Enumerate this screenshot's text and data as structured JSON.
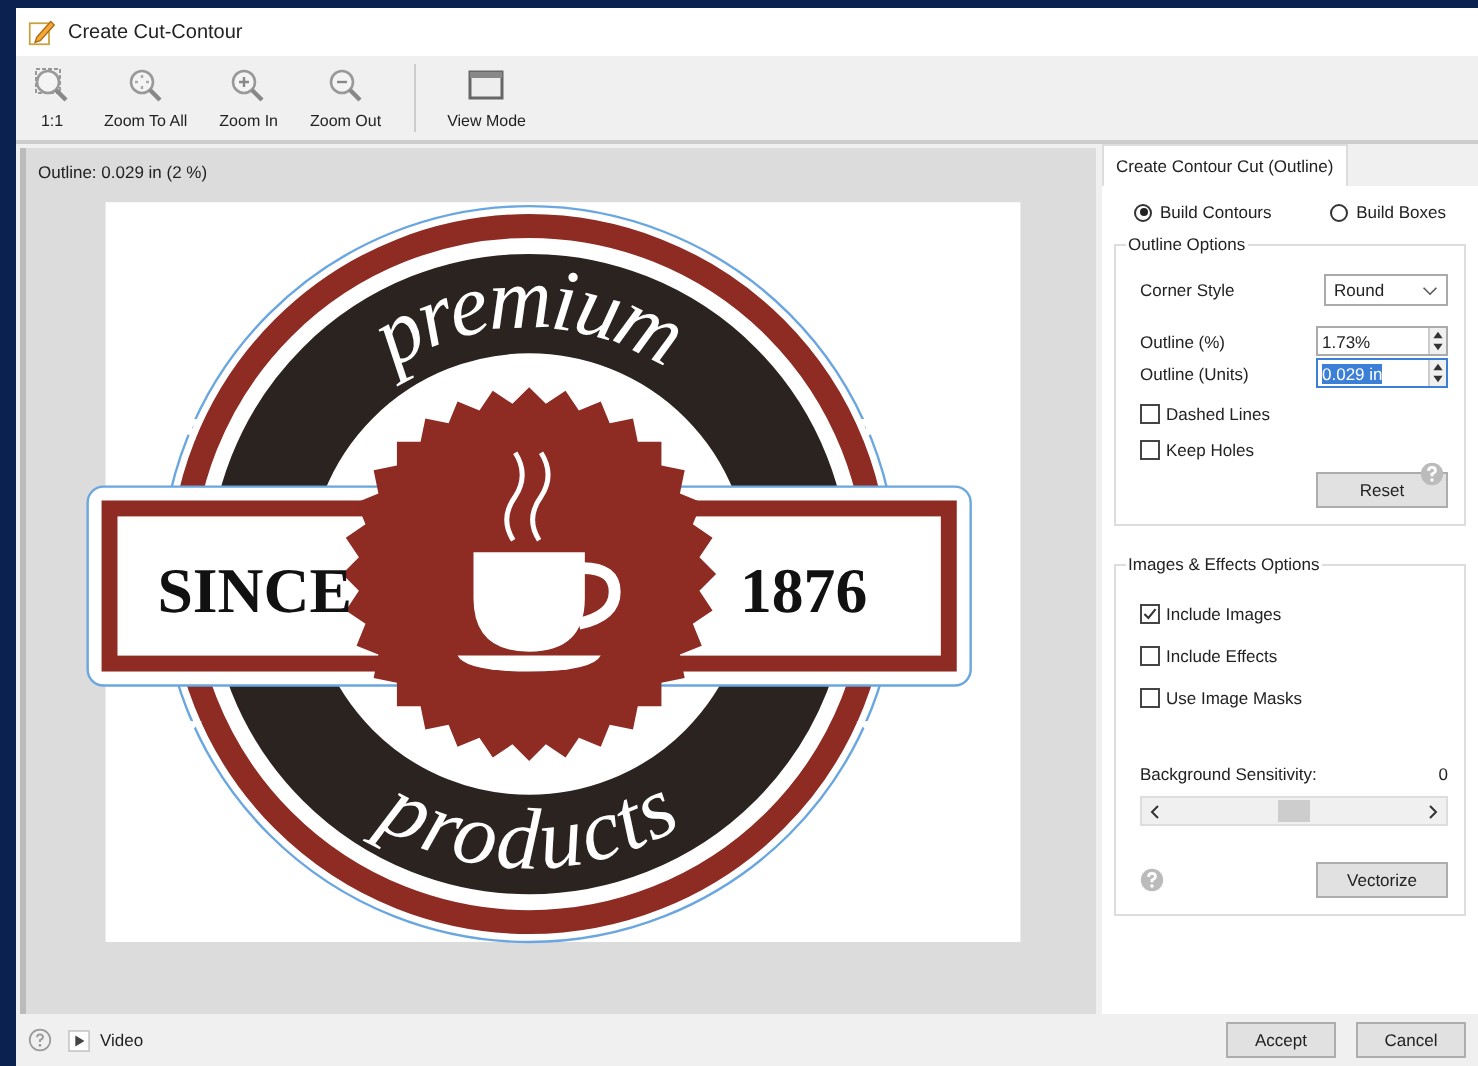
{
  "window": {
    "title": "Create Cut-Contour"
  },
  "toolbar": [
    {
      "label": "1:1",
      "kind": "actual"
    },
    {
      "label": "Zoom To All",
      "kind": "zoom_all"
    },
    {
      "label": "Zoom In",
      "kind": "zoom_in"
    },
    {
      "label": "Zoom Out",
      "kind": "zoom_out"
    },
    {
      "label": "View Mode",
      "kind": "view_mode"
    }
  ],
  "canvas": {
    "status": "Outline: 0.029 in (2 %)",
    "artwork": {
      "top_text": "premium",
      "left_text": "SINCE",
      "right_text": "1876",
      "bottom_text": "products"
    }
  },
  "panel": {
    "tab": "Create Contour Cut (Outline)",
    "modes": [
      {
        "label": "Build Contours",
        "selected": true
      },
      {
        "label": "Build Boxes",
        "selected": false
      }
    ],
    "outline_options": {
      "title": "Outline Options",
      "corner_style": {
        "label": "Corner Style",
        "value": "Round"
      },
      "outline_percent": {
        "label": "Outline (%)",
        "value": "1.73%"
      },
      "outline_units": {
        "label": "Outline (Units)",
        "value": "0.029 in",
        "selected": true
      },
      "checkboxes": [
        {
          "label": "Dashed Lines",
          "checked": false
        },
        {
          "label": "Keep Holes",
          "checked": false
        }
      ],
      "reset": "Reset"
    },
    "effects": {
      "title": "Images & Effects Options",
      "checkboxes": [
        {
          "label": "Include Images",
          "checked": true
        },
        {
          "label": "Include Effects",
          "checked": false
        },
        {
          "label": "Use Image Masks",
          "checked": false
        }
      ],
      "sensitivity": {
        "label": "Background Sensitivity:",
        "reading": "0",
        "level": 0.5
      },
      "vectorize": "Vectorize"
    }
  },
  "footer": {
    "video": "Video",
    "buttons": [
      "Accept",
      "Cancel"
    ]
  }
}
